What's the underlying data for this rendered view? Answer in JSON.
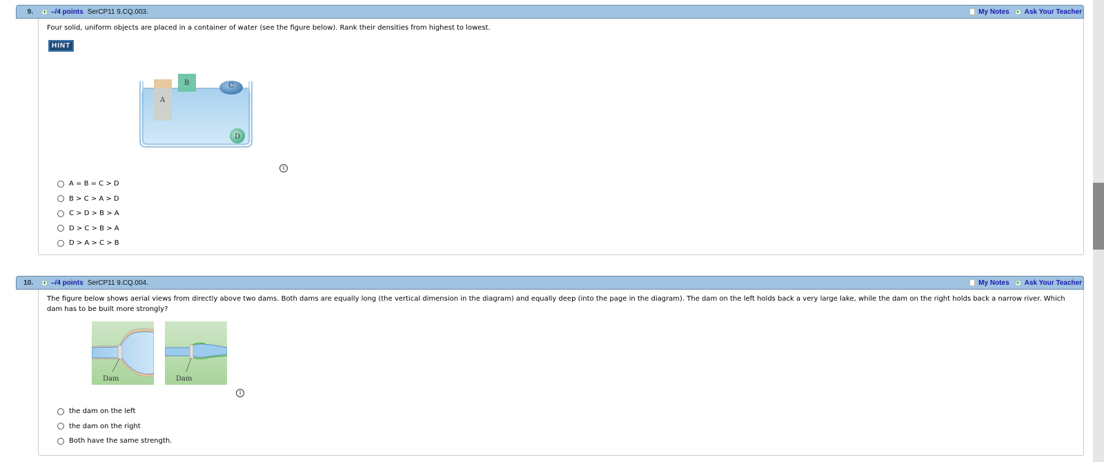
{
  "questions": [
    {
      "number": "9.",
      "points": "–/4 points",
      "id": "SerCP11 9.CQ.003.",
      "my_notes": "My Notes",
      "ask_teacher": "Ask Your Teacher",
      "prompt": "Four solid, uniform objects are placed in a container of water (see the figure below). Rank their densities from highest to lowest.",
      "hint_label": "HINT",
      "figure_labels": [
        "A",
        "B",
        "C",
        "D"
      ],
      "info_icon": "i",
      "options": [
        "A = B = C > D",
        "B > C > A > D",
        "C > D > B > A",
        "D > C > B > A",
        "D > A > C > B"
      ]
    },
    {
      "number": "10.",
      "points": "–/4 points",
      "id": "SerCP11 9.CQ.004.",
      "my_notes": "My Notes",
      "ask_teacher": "Ask Your Teacher",
      "prompt": "The figure below shows aerial views from directly above two dams. Both dams are equally long (the vertical dimension in the diagram) and equally deep (into the page in the diagram). The dam on the left holds back a very large lake, while the dam on the right holds back a narrow river. Which dam has to be built more strongly?",
      "figure_labels": [
        "Dam",
        "Dam"
      ],
      "info_icon": "i",
      "options": [
        "the dam on the left",
        "the dam on the right",
        "Both have the same strength."
      ]
    }
  ],
  "colors": {
    "header_bg": "#9fc3e0",
    "link": "#1a1aaa",
    "hint_bg": "#1f4a78"
  }
}
